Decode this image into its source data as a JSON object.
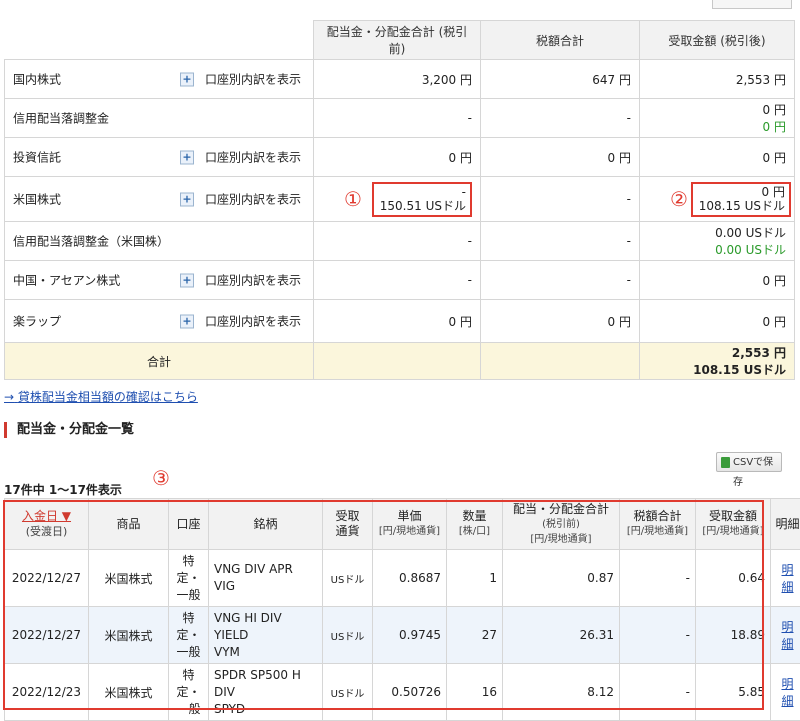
{
  "summary": {
    "headers": [
      "配当金・分配金合計 (税引前)",
      "税額合計",
      "受取金額 (税引後)"
    ],
    "expand_label": "口座別内訳を表示",
    "rows": [
      {
        "name": "国内株式",
        "expand": true,
        "pre": "3,200 円",
        "pre2": "",
        "tax": "647 円",
        "net": "2,553 円",
        "net2": ""
      },
      {
        "name": "信用配当落調整金",
        "expand": false,
        "pre": "-",
        "pre2": "",
        "tax": "-",
        "net": "0 円",
        "net2": "0 円"
      },
      {
        "name": "投資信託",
        "expand": true,
        "pre": "0 円",
        "pre2": "",
        "tax": "0 円",
        "net": "0 円",
        "net2": ""
      },
      {
        "name": "米国株式",
        "expand": true,
        "pre": "-",
        "pre2": "150.51 USドル",
        "tax": "-",
        "net": "0 円",
        "net2": "108.15 USドル"
      },
      {
        "name": "信用配当落調整金（米国株）",
        "expand": false,
        "pre": "-",
        "pre2": "",
        "tax": "-",
        "net": "0.00 USドル",
        "net2": "0.00 USドル"
      },
      {
        "name": "中国・アセアン株式",
        "expand": true,
        "pre": "-",
        "pre2": "",
        "tax": "-",
        "net": "0 円",
        "net2": ""
      },
      {
        "name": "楽ラップ",
        "expand": true,
        "pre": "0 円",
        "pre2": "",
        "tax": "0 円",
        "net": "0 円",
        "net2": ""
      }
    ],
    "total_label": "合計",
    "total_net": "2,553 円",
    "total_net2": "108.15 USドル"
  },
  "markers": {
    "m1": "①",
    "m2": "②",
    "m3": "③"
  },
  "lending_link": "貸株配当金相当額の確認はこちら",
  "section_title": "配当金・分配金一覧",
  "csv_button": "CSVで保存",
  "count_text": "17件中 1〜17件表示",
  "list": {
    "headers": {
      "date": "入金日 ▼",
      "date_sub": "(受渡日)",
      "product": "商品",
      "account": "口座",
      "name": "銘柄",
      "currency": "受取\n通貨",
      "unit": "単価",
      "unit_sub": "[円/現地通貨]",
      "qty": "数量",
      "qty_sub": "[株/口]",
      "pre": "配当・分配金合計",
      "pre_sub1": "(税引前)",
      "pre_sub2": "[円/現地通貨]",
      "tax": "税額合計",
      "tax_sub": "[円/現地通貨]",
      "net": "受取金額",
      "net_sub": "[円/現地通貨]",
      "detail": "明細"
    },
    "rows": [
      {
        "date": "2022/12/27",
        "product": "米国株式",
        "account": [
          "特",
          "定・",
          "一般"
        ],
        "name": [
          "VNG DIV APR",
          "VIG"
        ],
        "currency": "USドル",
        "unit": "0.8687",
        "qty": "1",
        "pre": "0.87",
        "tax": "-",
        "net": "0.64",
        "detail": "明細"
      },
      {
        "date": "2022/12/27",
        "product": "米国株式",
        "account": [
          "特",
          "定・",
          "一般"
        ],
        "name": [
          "VNG HI DIV",
          "YIELD",
          "VYM"
        ],
        "currency": "USドル",
        "unit": "0.9745",
        "qty": "27",
        "pre": "26.31",
        "tax": "-",
        "net": "18.89",
        "detail": "明細"
      },
      {
        "date": "2022/12/23",
        "product": "米国株式",
        "account": [
          "特",
          "定・",
          "一般"
        ],
        "name": [
          "SPDR SP500 H",
          "DIV",
          "SPYD"
        ],
        "currency": "USドル",
        "unit": "0.50726",
        "qty": "16",
        "pre": "8.12",
        "tax": "-",
        "net": "5.85",
        "detail": "明細"
      }
    ]
  }
}
